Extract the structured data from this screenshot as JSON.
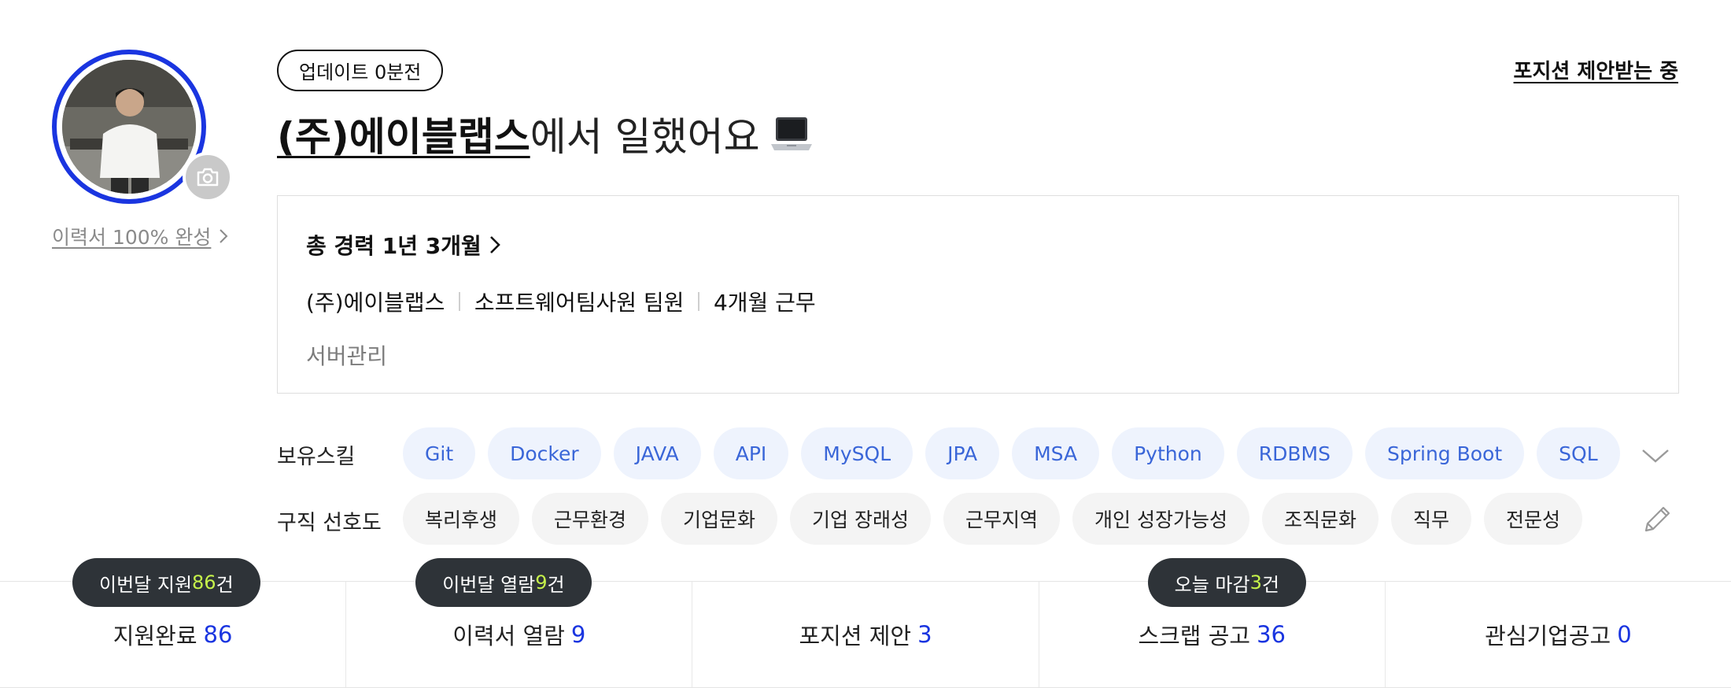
{
  "profile": {
    "resume_complete": "이력서 100% 완성"
  },
  "header": {
    "update_badge": "업데이트 0분전",
    "offer_link": "포지션 제안받는 중",
    "company": "(주)에이블랩스",
    "headline_rest": "에서 일했어요"
  },
  "career": {
    "total": "총 경력 1년 3개월",
    "company": "(주)에이블랩스",
    "position": "소프트웨어팀사원 팀원",
    "duration": "4개월 근무",
    "duty": "서버관리"
  },
  "skills": {
    "label": "보유스킬",
    "items": [
      "Git",
      "Docker",
      "JAVA",
      "API",
      "MySQL",
      "JPA",
      "MSA",
      "Python",
      "RDBMS",
      "Spring Boot",
      "SQL"
    ]
  },
  "preferences": {
    "label": "구직 선호도",
    "items": [
      "복리후생",
      "근무환경",
      "기업문화",
      "기업 장래성",
      "근무지역",
      "개인 성장가능성",
      "조직문화",
      "직무",
      "전문성"
    ]
  },
  "stats": [
    {
      "label": "지원완료",
      "value": "86",
      "tooltip": {
        "prefix": "이번달 지원 ",
        "value": "86",
        "suffix": "건"
      }
    },
    {
      "label": "이력서 열람",
      "value": "9",
      "tooltip": {
        "prefix": "이번달 열람 ",
        "value": "9",
        "suffix": "건"
      }
    },
    {
      "label": "포지션 제안",
      "value": "3"
    },
    {
      "label": "스크랩 공고",
      "value": "36",
      "tooltip": {
        "prefix": "오늘 마감 ",
        "value": "3",
        "suffix": "건"
      }
    },
    {
      "label": "관심기업공고",
      "value": "0"
    }
  ],
  "colors": {
    "accent_blue": "#1a35e0",
    "skill_text": "#3a66d8",
    "tooltip_bg": "#2e3338",
    "tooltip_highlight": "#c6f34a"
  },
  "icons": [
    "camera-icon",
    "chevron-right-icon",
    "laptop-icon",
    "chevron-down-icon",
    "pencil-icon"
  ]
}
